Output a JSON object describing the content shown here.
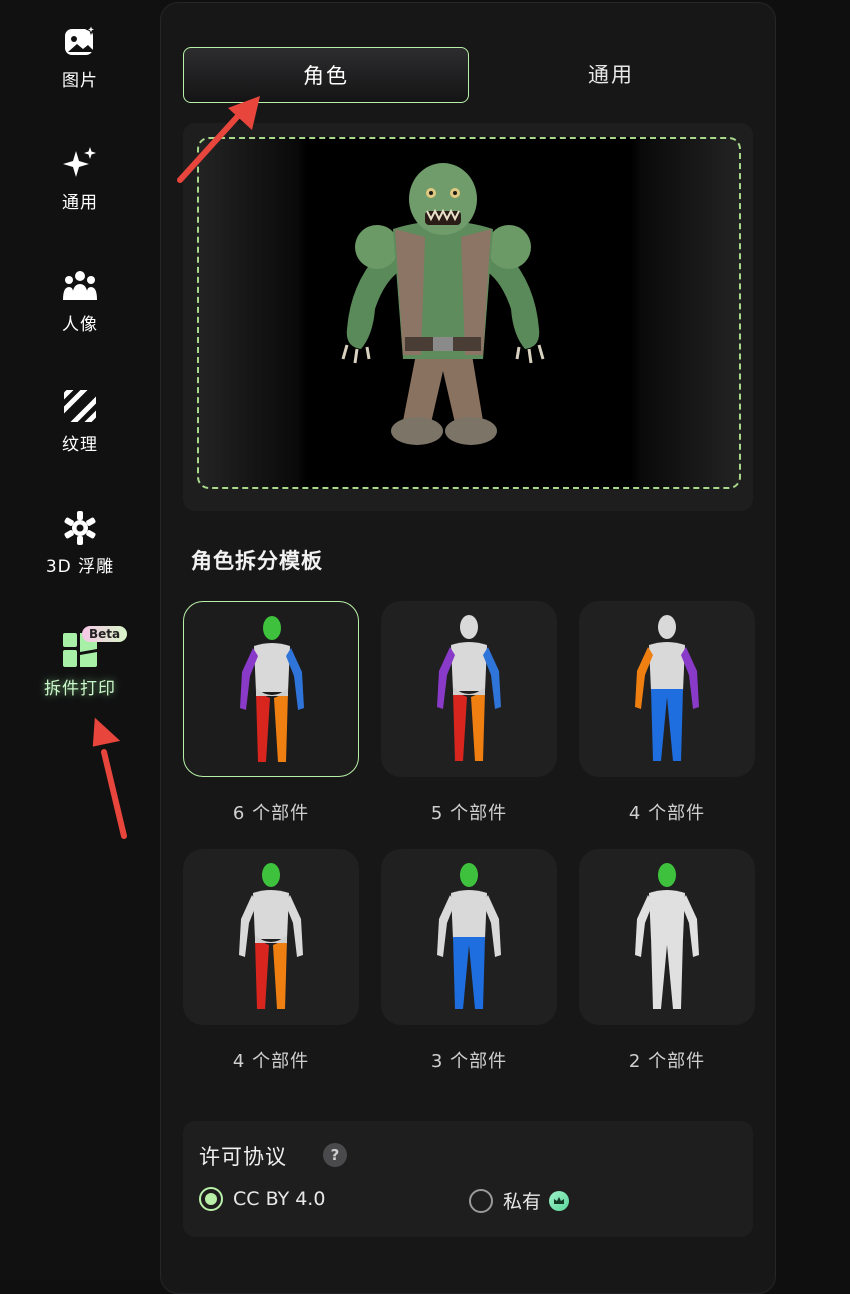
{
  "sidebar": {
    "items": [
      {
        "label": "图片",
        "icon": "image-icon"
      },
      {
        "label": "通用",
        "icon": "sparkle-icon"
      },
      {
        "label": "人像",
        "icon": "people-icon"
      },
      {
        "label": "纹理",
        "icon": "texture-icon"
      },
      {
        "label": "3D 浮雕",
        "icon": "relief-icon"
      },
      {
        "label": "拆件打印",
        "icon": "parts-print-icon",
        "badge": "Beta",
        "active": true
      }
    ]
  },
  "tabs": [
    {
      "label": "角色",
      "active": true
    },
    {
      "label": "通用",
      "active": false
    }
  ],
  "template_section": {
    "title": "角色拆分模板",
    "templates": [
      {
        "label": "6 个部件",
        "selected": true
      },
      {
        "label": "5 个部件",
        "selected": false
      },
      {
        "label": "4 个部件",
        "selected": false
      },
      {
        "label": "4 个部件",
        "selected": false
      },
      {
        "label": "3 个部件",
        "selected": false
      },
      {
        "label": "2 个部件",
        "selected": false
      }
    ]
  },
  "license": {
    "title": "许可协议",
    "help": "?",
    "options": [
      {
        "label": "CC BY 4.0",
        "checked": true
      },
      {
        "label": "私有",
        "checked": false,
        "icon": "crown-icon"
      }
    ]
  },
  "colors": {
    "accent": "#b8f0a8",
    "background": "#0f0f10",
    "panel": "#171718"
  }
}
